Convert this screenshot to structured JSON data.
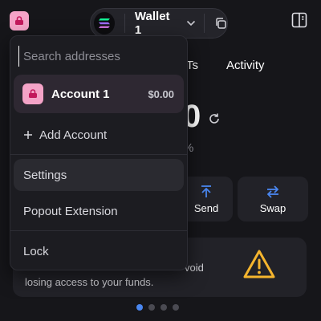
{
  "header": {
    "wallet_name": "Wallet 1"
  },
  "tabs": {
    "nfts_partial": "Ts",
    "activity": "Activity"
  },
  "balance": {
    "partial_value": "0",
    "partial_change": "%"
  },
  "actions": {
    "send_partial": "Send",
    "swap": "Swap"
  },
  "warning": {
    "line1_partial": "void",
    "line2": "losing access to your funds."
  },
  "menu": {
    "search_placeholder": "Search addresses",
    "account": {
      "name": "Account 1",
      "balance": "$0.00"
    },
    "add_account": "Add Account",
    "items": [
      {
        "label": "Settings"
      },
      {
        "label": "Popout Extension"
      },
      {
        "label": "Lock"
      }
    ]
  },
  "pagination": {
    "total": 4,
    "active": 1
  },
  "colors": {
    "background": "#16161a",
    "menu_bg": "#1c1c21",
    "accent_blue": "#4a87f0",
    "warning_yellow": "#f5b52e",
    "account_pink": "#f4a3c7"
  },
  "icons": [
    "app-avatar-icon",
    "solana-icon",
    "chevron-down-icon",
    "copy-icon",
    "sidebar-icon",
    "refresh-icon",
    "send-arrow-icon",
    "swap-arrows-icon",
    "warning-triangle-icon",
    "plus-icon"
  ]
}
